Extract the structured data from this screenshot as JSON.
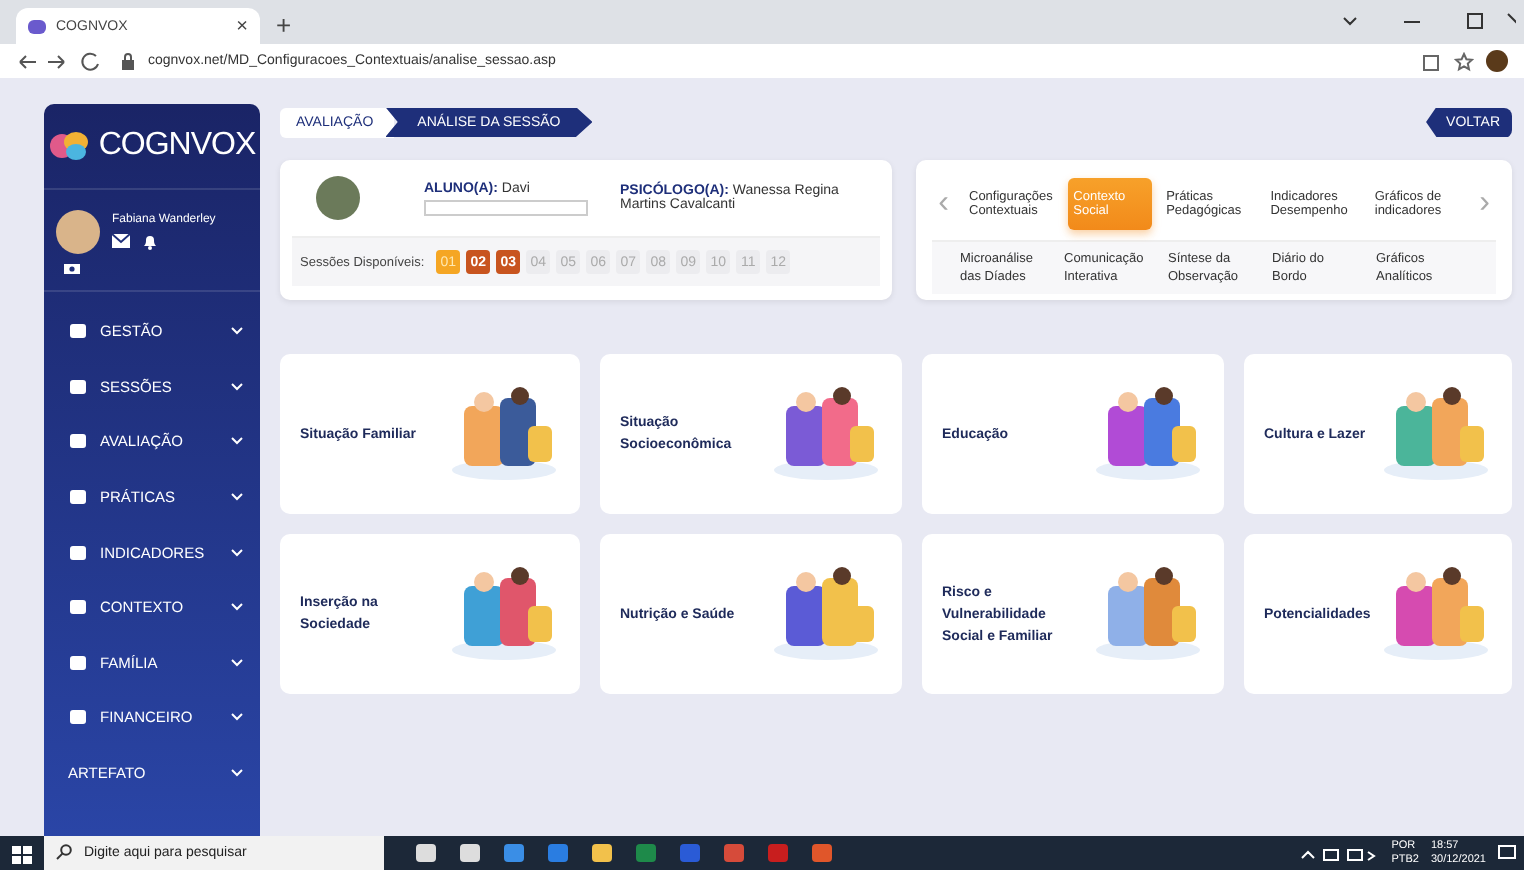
{
  "browser": {
    "tab_title": "COGNVOX",
    "close": "×",
    "new_tab": "+",
    "url": "cognvox.net/MD_Configuracoes_Contextuais/analise_sessao.asp"
  },
  "sidebar": {
    "logo": "COGNVOX",
    "user": "Fabiana Wanderley",
    "items": [
      {
        "label": "GESTÃO",
        "kind": "icon"
      },
      {
        "label": "SESSÕES",
        "kind": "icon"
      },
      {
        "label": "AVALIAÇÃO",
        "kind": "icon"
      },
      {
        "label": "PRÁTICAS",
        "kind": "icon"
      },
      {
        "label": "INDICADORES",
        "kind": "icon"
      },
      {
        "label": "CONTEXTO",
        "kind": "icon"
      },
      {
        "label": "FAMÍLIA",
        "kind": "icon"
      },
      {
        "label": "FINANCEIRO",
        "kind": "icon"
      },
      {
        "label": "ARTEFATO",
        "kind": "plain"
      }
    ]
  },
  "breadcrumb": [
    {
      "label": "AVALIAÇÃO",
      "selected": false
    },
    {
      "label": "ANÁLISE DA SESSÃO",
      "selected": true
    }
  ],
  "back_button": "VOLTAR",
  "patient": {
    "student_label": "ALUNO(A):",
    "student": "Davi",
    "psychologist_label": "PSICÓLOGO(A):",
    "psychologist": "Wanessa Regina Martins Cavalcanti",
    "sessions_label": "Sessões Disponíveis:",
    "sessions": [
      {
        "number": "01",
        "kind": "current"
      },
      {
        "number": "02",
        "kind": "done"
      },
      {
        "number": "03",
        "kind": "done"
      },
      {
        "number": "04",
        "kind": "empty"
      },
      {
        "number": "05",
        "kind": "empty"
      },
      {
        "number": "06",
        "kind": "empty"
      },
      {
        "number": "07",
        "kind": "empty"
      },
      {
        "number": "08",
        "kind": "empty"
      },
      {
        "number": "09",
        "kind": "empty"
      },
      {
        "number": "10",
        "kind": "empty"
      },
      {
        "number": "11",
        "kind": "empty"
      },
      {
        "number": "12",
        "kind": "empty"
      }
    ]
  },
  "tabs": {
    "prev": "‹",
    "next": "›",
    "items": [
      {
        "label": "Configurações Contextuais",
        "selected": false
      },
      {
        "label": "Contexto Social",
        "selected": true
      },
      {
        "label": "Práticas Pedagógicas",
        "selected": false
      },
      {
        "label": "Indicadores Desempenho",
        "selected": false
      },
      {
        "label": "Gráficos de indicadores",
        "selected": false
      }
    ],
    "subitems": [
      "Microanálise das Díades",
      "Comunicação Interativa",
      "Síntese da Observação",
      "Diário do Bordo",
      "Gráficos Analíticos"
    ]
  },
  "cards": [
    {
      "title": "Situação Familiar"
    },
    {
      "title": "Situação Socioeconômica"
    },
    {
      "title": "Educação"
    },
    {
      "title": "Cultura e Lazer"
    },
    {
      "title": "Inserção na Sociedade"
    },
    {
      "title": "Nutrição e Saúde"
    },
    {
      "title": "Risco e Vulnerabilidade Social e Familiar"
    },
    {
      "title": "Potencialidades"
    }
  ],
  "taskbar": {
    "search_placeholder": "Digite aqui para pesquisar",
    "lang_top": "POR",
    "lang_bottom": "PTB2",
    "time": "18:57",
    "date": "30/12/2021"
  }
}
